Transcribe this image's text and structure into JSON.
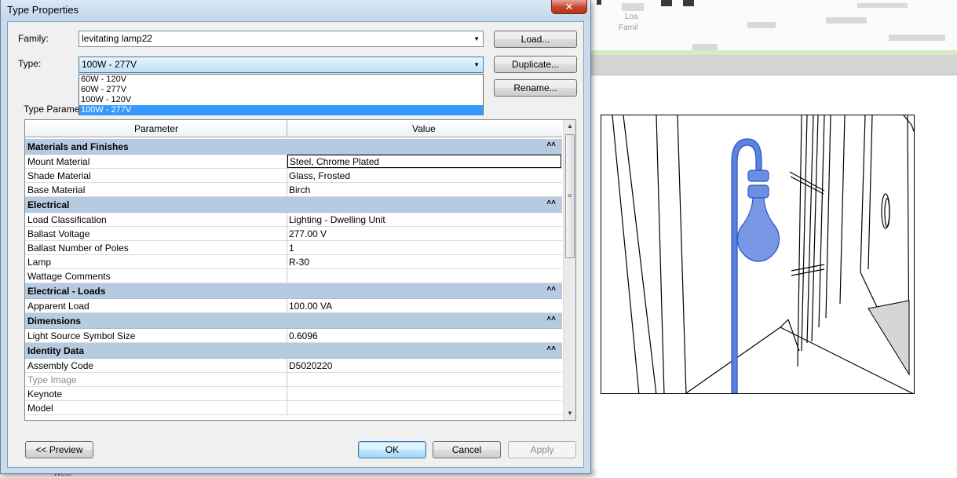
{
  "window": {
    "title": "Type Properties",
    "close_glyph": "✕"
  },
  "family": {
    "label": "Family:",
    "value": "levitating lamp22"
  },
  "type": {
    "label": "Type:",
    "value": "100W - 277V",
    "options": [
      "60W - 120V",
      "60W - 277V",
      "100W - 120V",
      "100W - 277V"
    ],
    "selected_index": 3
  },
  "buttons": {
    "load": "Load...",
    "duplicate": "Duplicate...",
    "rename": "Rename...",
    "preview": "<< Preview",
    "ok": "OK",
    "cancel": "Cancel",
    "apply": "Apply"
  },
  "type_parameters_label": "Type Parameters",
  "grid": {
    "columns": [
      "Parameter",
      "Value"
    ],
    "groups": [
      {
        "name": "Materials and Finishes",
        "rows": [
          {
            "param": "Mount Material",
            "value": "Steel, Chrome Plated",
            "editing": true
          },
          {
            "param": "Shade Material",
            "value": "Glass, Frosted"
          },
          {
            "param": "Base Material",
            "value": "Birch"
          }
        ]
      },
      {
        "name": "Electrical",
        "rows": [
          {
            "param": "Load Classification",
            "value": "Lighting - Dwelling Unit"
          },
          {
            "param": "Ballast Voltage",
            "value": "277.00 V"
          },
          {
            "param": "Ballast Number of Poles",
            "value": "1"
          },
          {
            "param": "Lamp",
            "value": "R-30"
          },
          {
            "param": "Wattage Comments",
            "value": ""
          }
        ]
      },
      {
        "name": "Electrical - Loads",
        "rows": [
          {
            "param": "Apparent Load",
            "value": "100.00 VA"
          }
        ]
      },
      {
        "name": "Dimensions",
        "rows": [
          {
            "param": "Light Source Symbol Size",
            "value": "0.6096"
          }
        ]
      },
      {
        "name": "Identity Data",
        "rows": [
          {
            "param": "Assembly Code",
            "value": "D5020220"
          },
          {
            "param": "Type Image",
            "value": "",
            "dim": true
          },
          {
            "param": "Keynote",
            "value": ""
          },
          {
            "param": "Model",
            "value": ""
          }
        ]
      }
    ]
  },
  "background": {
    "status_text": "West",
    "ghost_text_1": "Loa",
    "ghost_text_2": "Famil"
  },
  "colors": {
    "group_header": "#b7cbe0",
    "selection": "#3399ff",
    "lamp_fill": "#6b8fe0",
    "lamp_stroke": "#2d55c8"
  },
  "icons": {
    "collapse": "collapse-group-icon",
    "dropdown": "chevron-down-icon"
  }
}
